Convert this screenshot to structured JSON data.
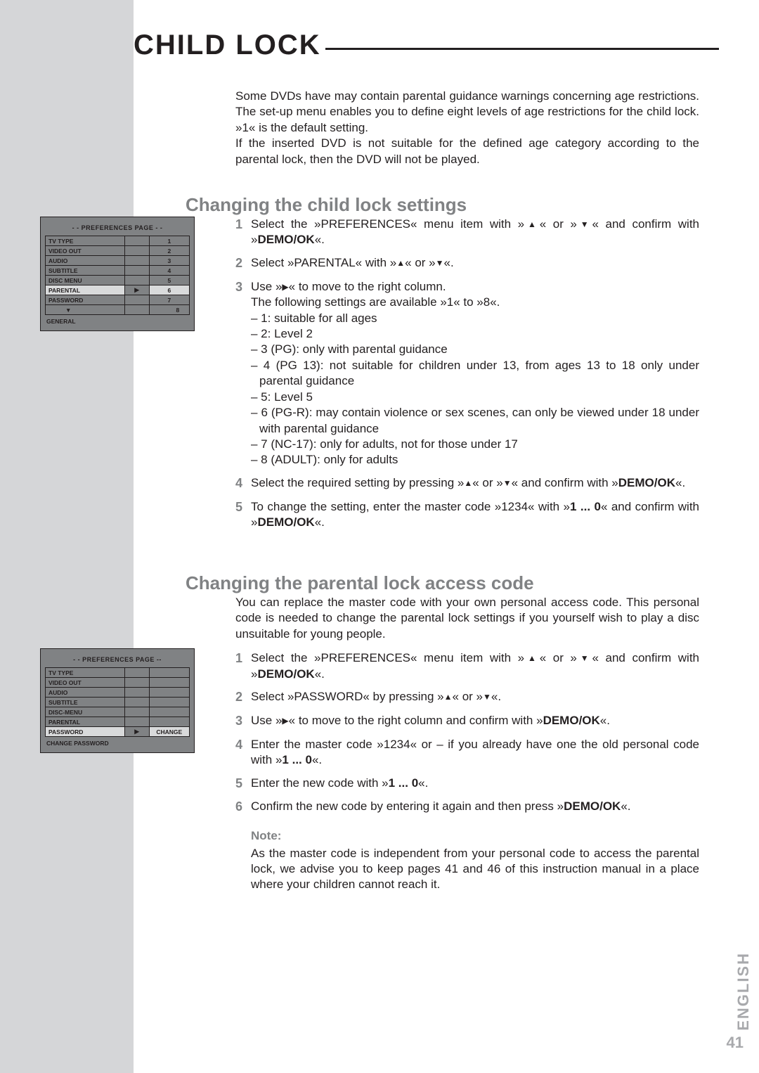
{
  "page": {
    "title": "CHILD LOCK",
    "language": "ENGLISH",
    "number": "41"
  },
  "intro": {
    "p1": "Some DVDs have may contain parental guidance warnings concerning age restrictions. The set-up menu enables you to define eight levels of age restrictions for the child lock. »1« is the default setting.",
    "p2": "If the inserted DVD is not suitable for the defined age category according to the parental lock, then the DVD will not be played."
  },
  "section1": {
    "heading": "Changing the child lock settings",
    "steps": {
      "s1a": "Select the »PREFERENCES« menu item with »",
      "s1b": "« or »",
      "s1c": "« and confirm with »",
      "s1d": "DEMO/OK",
      "s1e": "«.",
      "s2a": "Select »PARENTAL« with »",
      "s2b": "« or »",
      "s2c": "«.",
      "s3a": "Use »",
      "s3b": "« to move to the right column.",
      "s3c": "The following settings are available »1« to »8«.",
      "l1": "– 1: suitable for all ages",
      "l2": "– 2: Level 2",
      "l3": "– 3 (PG): only with parental guidance",
      "l4": "– 4 (PG 13): not suitable for children under 13, from ages 13 to 18 only under parental guidance",
      "l5": "– 5: Level 5",
      "l6": "– 6 (PG-R): may contain violence or sex scenes, can only be viewed under 18 under with parental guidance",
      "l7": "– 7 (NC-17): only for adults, not for those under 17",
      "l8": "– 8 (ADULT): only for adults",
      "s4a": "Select the required setting by pressing »",
      "s4b": "« or »",
      "s4c": "« and confirm with »",
      "s4d": "DEMO/OK",
      "s4e": "«.",
      "s5a": "To change the setting, enter the master code »1234« with »",
      "s5b": "1 ... 0",
      "s5c": "« and confirm with »",
      "s5d": "DEMO/OK",
      "s5e": "«."
    },
    "nums": {
      "n1": "1",
      "n2": "2",
      "n3": "3",
      "n4": "4",
      "n5": "5"
    }
  },
  "section2": {
    "heading": "Changing the parental lock access code",
    "intro": "You can replace the master code with your own personal access code. This personal code is needed to change the parental lock settings if you yourself wish to play a disc unsuitable for young people.",
    "steps": {
      "s1a": "Select the »PREFERENCES« menu item with »",
      "s1b": "« or »",
      "s1c": "« and confirm with »",
      "s1d": "DEMO/OK",
      "s1e": "«.",
      "s2a": "Select »PASSWORD« by pressing »",
      "s2b": "« or »",
      "s2c": "«.",
      "s3a": "Use »",
      "s3b": "« to move to the right column and confirm with »",
      "s3c": "DEMO/OK",
      "s3d": "«.",
      "s4a": "Enter the master code »1234« or – if you already have one the old personal code with »",
      "s4b": "1 ... 0",
      "s4c": "«.",
      "s5a": "Enter the new code with »",
      "s5b": "1 ... 0",
      "s5c": "«.",
      "s6a": "Confirm the new code by entering it again and then press »",
      "s6b": "DEMO/OK",
      "s6c": "«."
    },
    "nums": {
      "n1": "1",
      "n2": "2",
      "n3": "3",
      "n4": "4",
      "n5": "5",
      "n6": "6"
    },
    "note_label": "Note:",
    "note": "As the master code is independent from your personal code to access the parental lock, we advise you to keep pages 41 and 46 of this instruction manual in a place where your children cannot reach it."
  },
  "osd1": {
    "header": "- - PREFERENCES PAGE - -",
    "rows": [
      {
        "l": "TV TYPE",
        "r": "1"
      },
      {
        "l": "VIDEO OUT",
        "r": "2"
      },
      {
        "l": "AUDIO",
        "r": "3"
      },
      {
        "l": "SUBTITLE",
        "r": "4"
      },
      {
        "l": "DISC MENU",
        "r": "5"
      },
      {
        "l": "PARENTAL",
        "r": "6",
        "sel": true
      },
      {
        "l": "PASSWORD",
        "r": "7"
      }
    ],
    "extra_r": "8",
    "footer": "GENERAL"
  },
  "osd2": {
    "header": "- - PREFERENCES PAGE --",
    "rows": [
      {
        "l": "TV TYPE"
      },
      {
        "l": "VIDEO OUT"
      },
      {
        "l": "AUDIO"
      },
      {
        "l": "SUBTITLE"
      },
      {
        "l": "DISC-MENU"
      },
      {
        "l": "PARENTAL"
      },
      {
        "l": "PASSWORD",
        "r": "CHANGE",
        "sel": true
      }
    ],
    "footer": "CHANGE PASSWORD"
  }
}
